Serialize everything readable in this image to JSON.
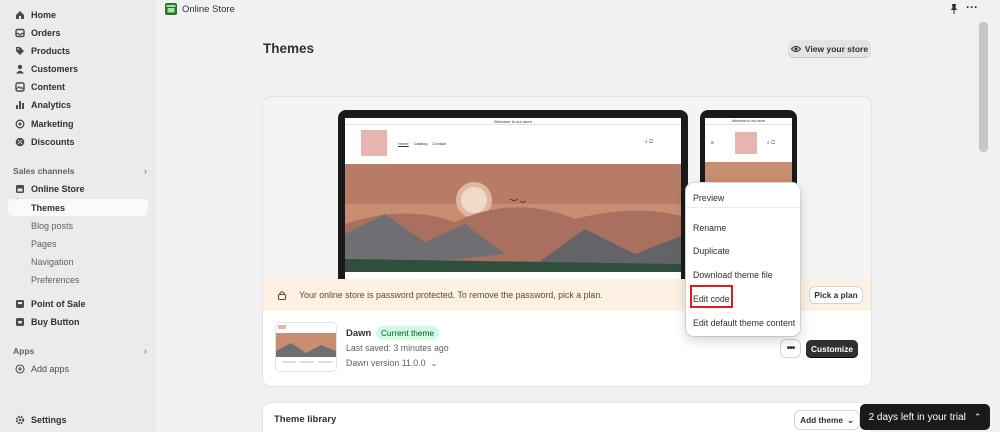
{
  "sidebar": {
    "items": [
      {
        "label": "Home",
        "icon": "home-icon"
      },
      {
        "label": "Orders",
        "icon": "orders-icon"
      },
      {
        "label": "Products",
        "icon": "tag-icon"
      },
      {
        "label": "Customers",
        "icon": "person-icon"
      },
      {
        "label": "Content",
        "icon": "content-icon"
      },
      {
        "label": "Analytics",
        "icon": "bar-chart-icon"
      },
      {
        "label": "Marketing",
        "icon": "target-icon"
      },
      {
        "label": "Discounts",
        "icon": "discount-icon"
      }
    ],
    "sales_channels_label": "Sales channels",
    "online_store": {
      "label": "Online Store",
      "subitems": [
        "Themes",
        "Blog posts",
        "Pages",
        "Navigation",
        "Preferences"
      ]
    },
    "point_of_sale": "Point of Sale",
    "buy_button": "Buy Button",
    "apps_label": "Apps",
    "add_apps": "Add apps",
    "settings": "Settings"
  },
  "topbar": {
    "title": "Online Store"
  },
  "page": {
    "title": "Themes",
    "view_store_label": "View your store"
  },
  "theme_card": {
    "banner_message": "Your online store is password protected. To remove the password, pick a plan.",
    "pick_plan_label": "Pick a plan",
    "theme_name": "Dawn",
    "current_badge": "Current theme",
    "last_saved": "Last saved: 3 minutes ago",
    "version": "Dawn version 11.0.0",
    "more_label": "•••",
    "customize_label": "Customize",
    "preview": {
      "laptop_top_text": "Welcome to our store",
      "nav": [
        "Home",
        "Catalog",
        "Contact"
      ],
      "phone_top_text": "Welcome to our store"
    }
  },
  "menu": {
    "items": [
      "Preview",
      "Rename",
      "Duplicate",
      "Download theme file",
      "Edit code",
      "Edit default theme content"
    ],
    "highlighted": "Edit code"
  },
  "library": {
    "title": "Theme library",
    "add_theme_label": "Add theme"
  },
  "trial": {
    "label": "2 days left in your trial"
  },
  "colors": {
    "highlight": "#e01b1b",
    "badge_bg": "#cdfee1",
    "banner_bg": "#fdf1e4"
  }
}
